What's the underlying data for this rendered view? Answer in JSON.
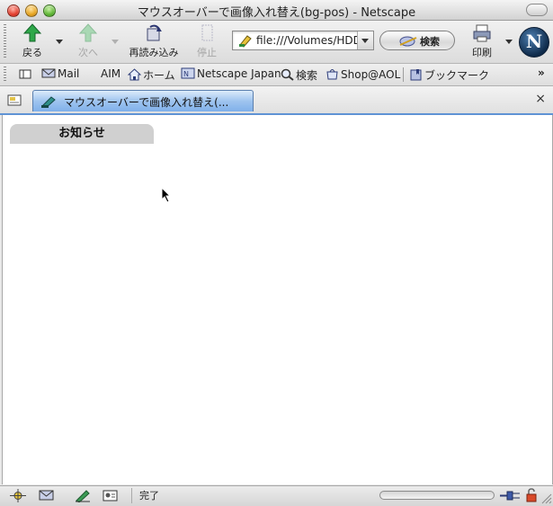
{
  "window": {
    "title": "マウスオーバーで画像入れ替え(bg-pos) - Netscape"
  },
  "toolbar": {
    "back_label": "戻る",
    "forward_label": "次へ",
    "reload_label": "再読み込み",
    "stop_label": "停止",
    "url_value": "file:///Volumes/HDD",
    "search_label": "検索",
    "print_label": "印刷",
    "logo_letter": "N"
  },
  "personal_toolbar": {
    "items": [
      {
        "label": "Mail",
        "icon": "mail-icon"
      },
      {
        "label": "AIM",
        "icon": "aim-icon"
      },
      {
        "label": "ホーム",
        "icon": "home-icon"
      },
      {
        "label": "Netscape Japan",
        "icon": "netscape-japan-icon"
      },
      {
        "label": "検索",
        "icon": "search-icon"
      },
      {
        "label": "Shop@AOL",
        "icon": "shop-icon"
      },
      {
        "label": "ブックマーク",
        "icon": "bookmarks-icon"
      }
    ],
    "overflow": "»"
  },
  "tabs": {
    "active_title": "マウスオーバーで画像入れ替え(...",
    "close_glyph": "×"
  },
  "content": {
    "notice_tab_label": "お知らせ"
  },
  "status": {
    "text": "完了"
  },
  "colors": {
    "tab_accent": "#7fb0ea",
    "notice_tab_bg": "#d0d0d0"
  }
}
